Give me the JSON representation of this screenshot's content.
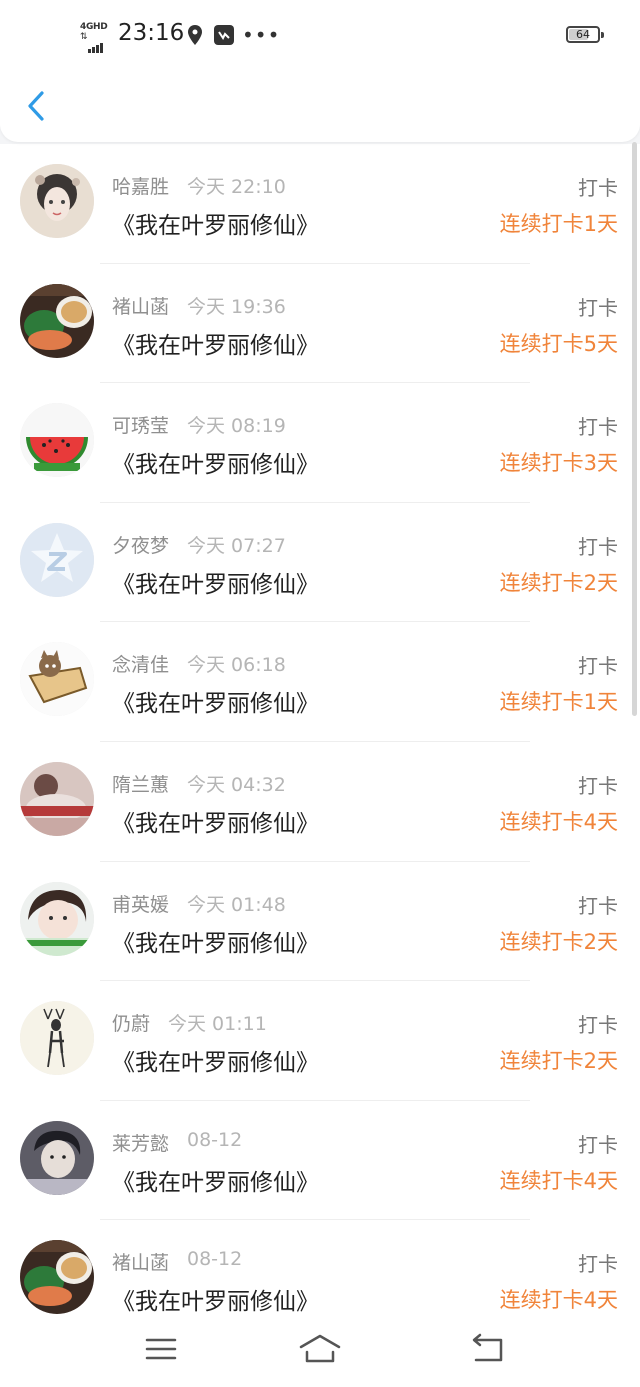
{
  "status_bar": {
    "network": "4GHD",
    "time": "23:16",
    "icons": [
      "location-pin-icon",
      "app-notification-icon",
      "more-dots-icon"
    ],
    "battery_level": "64"
  },
  "nav": {
    "back_icon": "chevron-left-icon",
    "accent_color": "#2f9be6"
  },
  "entries": [
    {
      "name": "哈嘉胜",
      "time": "今天 22:10",
      "book": "《我在叶罗丽修仙》",
      "action": "打卡",
      "streak": "连续打卡1天",
      "avatar": "girl-portrait"
    },
    {
      "name": "褚山菡",
      "time": "今天 19:36",
      "book": "《我在叶罗丽修仙》",
      "action": "打卡",
      "streak": "连续打卡5天",
      "avatar": "food-plate"
    },
    {
      "name": "可琇莹",
      "time": "今天 08:19",
      "book": "《我在叶罗丽修仙》",
      "action": "打卡",
      "streak": "连续打卡3天",
      "avatar": "watermelon"
    },
    {
      "name": "夕夜梦",
      "time": "今天 07:27",
      "book": "《我在叶罗丽修仙》",
      "action": "打卡",
      "streak": "连续打卡2天",
      "avatar": "default-z"
    },
    {
      "name": "念清佳",
      "time": "今天 06:18",
      "book": "《我在叶罗丽修仙》",
      "action": "打卡",
      "streak": "连续打卡1天",
      "avatar": "cat-box"
    },
    {
      "name": "隋兰蕙",
      "time": "今天 04:32",
      "book": "《我在叶罗丽修仙》",
      "action": "打卡",
      "streak": "连续打卡4天",
      "avatar": "person-photo"
    },
    {
      "name": "甫英媛",
      "time": "今天 01:48",
      "book": "《我在叶罗丽修仙》",
      "action": "打卡",
      "streak": "连续打卡2天",
      "avatar": "girl-face"
    },
    {
      "name": "仍蔚",
      "time": "今天 01:11",
      "book": "《我在叶罗丽修仙》",
      "action": "打卡",
      "streak": "连续打卡2天",
      "avatar": "deer"
    },
    {
      "name": "莱芳懿",
      "time": "08-12",
      "book": "《我在叶罗丽修仙》",
      "action": "打卡",
      "streak": "连续打卡4天",
      "avatar": "boy-portrait"
    },
    {
      "name": "褚山菡",
      "time": "08-12",
      "book": "《我在叶罗丽修仙》",
      "action": "打卡",
      "streak": "连续打卡4天",
      "avatar": "food-plate"
    }
  ],
  "streak_color": "#f0843a",
  "bottom_nav": {
    "icons": [
      "menu-icon",
      "home-icon",
      "back-icon"
    ]
  }
}
